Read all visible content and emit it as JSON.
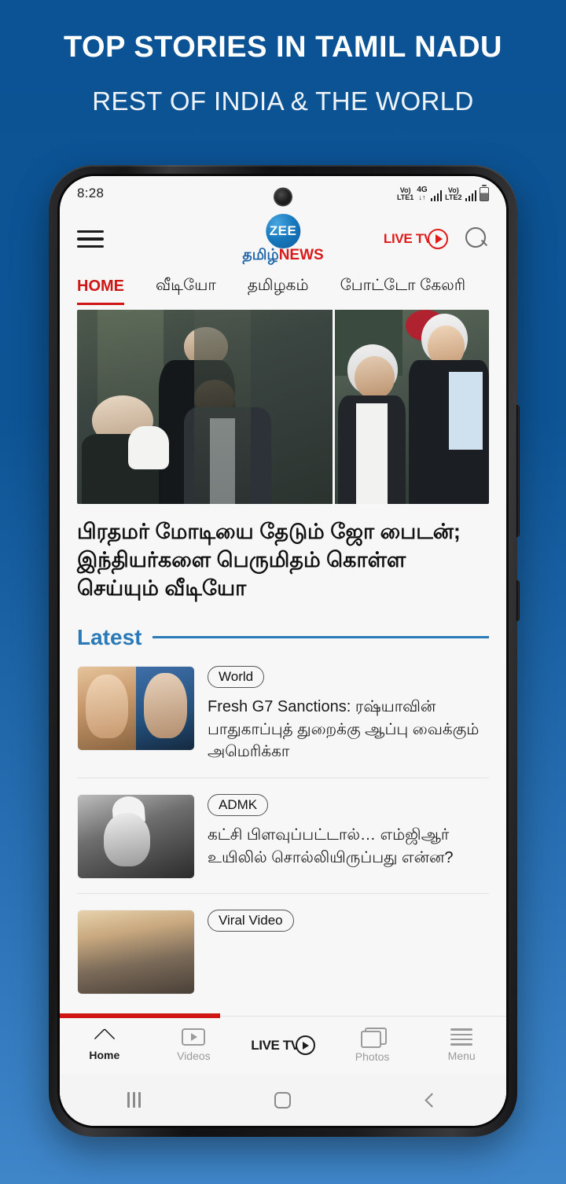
{
  "promo": {
    "title": "TOP STORIES IN TAMIL NADU",
    "subtitle": "REST OF INDIA & THE WORLD"
  },
  "statusbar": {
    "time": "8:28",
    "volte1_top": "Vo)",
    "volte1_bottom": "LTE1",
    "network": "4G",
    "data_arrows": "↓↑",
    "volte2_top": "Vo)",
    "volte2_bottom": "LTE2"
  },
  "appbar": {
    "logo_circle_text": "ZEE",
    "logo_tamil": "தமிழ்",
    "logo_news": "NEWS",
    "livetv_label": "LIVE TV"
  },
  "tabs": [
    {
      "label": "HOME",
      "active": true
    },
    {
      "label": "வீடியோ",
      "active": false
    },
    {
      "label": "தமிழகம்",
      "active": false
    },
    {
      "label": "போட்டோ கேலரி",
      "active": false
    }
  ],
  "hero": {
    "headline": "பிரதமர் மோடியை தேடும் ஜோ பைடன்; இந்தியர்களை பெருமிதம் கொள்ள செய்யும் வீடியோ"
  },
  "latest": {
    "section_title": "Latest",
    "items": [
      {
        "tag": "World",
        "title": "Fresh G7 Sanctions: ரஷ்யாவின் பாதுகாப்புத் துறைக்கு ஆப்பு வைக்கும் அமெரிக்கா"
      },
      {
        "tag": "ADMK",
        "title": "கட்சி பிளவுப்பட்டால்… எம்ஜிஆர் உயிலில் சொல்லியிருப்பது என்ன?"
      },
      {
        "tag": "Viral Video",
        "title": ""
      }
    ]
  },
  "bottomnav": [
    {
      "label": "Home",
      "active": true
    },
    {
      "label": "Videos",
      "active": false
    },
    {
      "label": "LIVE TV",
      "active": true
    },
    {
      "label": "Photos",
      "active": false
    },
    {
      "label": "Menu",
      "active": false
    }
  ],
  "colors": {
    "background_top": "#0b5394",
    "background_bottom": "#3f86c9",
    "accent_red": "#d01515",
    "accent_blue": "#2b7ab8"
  }
}
